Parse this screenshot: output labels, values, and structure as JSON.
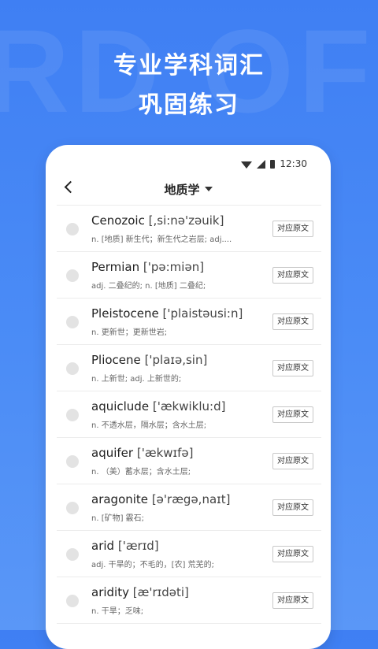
{
  "banner": {
    "line1": "专业学科词汇",
    "line2": "巩固练习",
    "deco_text": "RD OF"
  },
  "status": {
    "time": "12:30"
  },
  "header": {
    "title": "地质学"
  },
  "words": [
    {
      "word": "Cenozoic",
      "phonetic": "[,si:nə'zəuik]",
      "definition": "n. [地质] 新生代；新生代之岩层; adj....",
      "button": "对应原文"
    },
    {
      "word": "Permian",
      "phonetic": "['pə:miən]",
      "definition": "adj. 二叠纪的; n. [地质] 二叠纪;",
      "button": "对应原文"
    },
    {
      "word": "Pleistocene",
      "phonetic": "['plaistəusi:n]",
      "definition": "n. 更新世；更新世岩;",
      "button": "对应原文"
    },
    {
      "word": "Pliocene",
      "phonetic": "['plaɪə,sin]",
      "definition": "n. 上新世; adj. 上新世的;",
      "button": "对应原文"
    },
    {
      "word": "aquiclude",
      "phonetic": "['ækwiklu:d]",
      "definition": "n. 不透水层，隔水层；含水土层;",
      "button": "对应原文"
    },
    {
      "word": "aquifer",
      "phonetic": "['ækwɪfə]",
      "definition": "n. （美）蓄水层；含水土层;",
      "button": "对应原文"
    },
    {
      "word": "aragonite",
      "phonetic": "[ə'rægə,naɪt]",
      "definition": "n. [矿物] 霰石;",
      "button": "对应原文"
    },
    {
      "word": "arid",
      "phonetic": "['ærɪd]",
      "definition": "adj. 干旱的；不毛的，[农] 荒芜的;",
      "button": "对应原文"
    },
    {
      "word": "aridity",
      "phonetic": "[æ'rɪdəti]",
      "definition": "n. 干旱；乏味;",
      "button": "对应原文"
    }
  ]
}
